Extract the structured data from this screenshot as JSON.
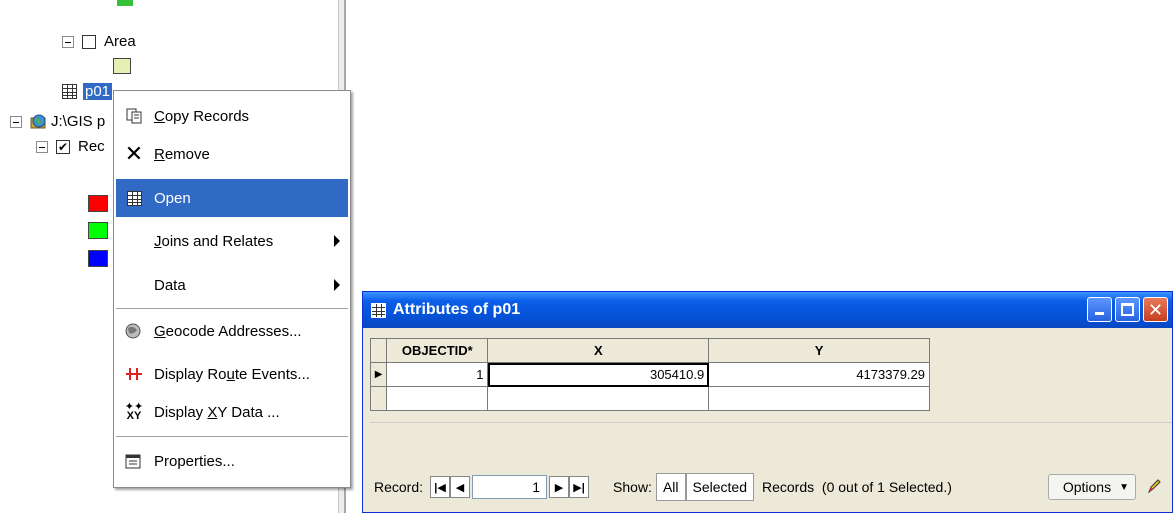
{
  "toc": {
    "area_label": "Area",
    "table_label": "p01",
    "path_label": "J:\\GIS p",
    "layer_label": "Rec",
    "legend_colors": [
      "#ff0000",
      "#00ff00",
      "#0000ff"
    ],
    "area_swatch_color": "#e6f0b4"
  },
  "context_menu": {
    "items": [
      {
        "label_pre": "",
        "label_u": "C",
        "label_post": "opy Records",
        "icon": "copy-icon"
      },
      {
        "label_pre": "",
        "label_u": "R",
        "label_post": "emove",
        "icon": "remove-icon"
      },
      {
        "label_pre": "Open",
        "label_u": "",
        "label_post": "",
        "icon": "table-icon"
      },
      {
        "label_pre": "",
        "label_u": "J",
        "label_post": "oins and Relates",
        "icon": ""
      },
      {
        "label_pre": "Data",
        "label_u": "",
        "label_post": "",
        "icon": ""
      },
      {
        "label_pre": "",
        "label_u": "G",
        "label_post": "eocode Addresses...",
        "icon": "geocode-icon"
      },
      {
        "label_pre": "Display Ro",
        "label_u": "u",
        "label_post": "te Events...",
        "icon": "route-events-icon"
      },
      {
        "label_pre": "Display ",
        "label_u": "X",
        "label_post": "Y Data ...",
        "icon": "xy-data-icon"
      },
      {
        "label_pre": "Properties...",
        "label_u": "",
        "label_post": "",
        "icon": "properties-icon"
      }
    ]
  },
  "attr_window": {
    "title": "Attributes of p01",
    "columns": [
      "OBJECTID*",
      "X",
      "Y"
    ],
    "rows": [
      [
        "1",
        "305410.9",
        "4173379.29"
      ]
    ],
    "status": {
      "record_label": "Record:",
      "record_value": "1",
      "show_label": "Show:",
      "all_label": "All",
      "selected_label": "Selected",
      "records_text": "Records  (0 out of 1 Selected.)",
      "options_label": "Options"
    }
  }
}
